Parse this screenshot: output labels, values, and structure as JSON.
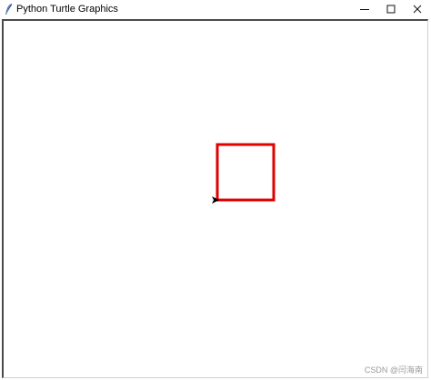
{
  "window": {
    "title": "Python Turtle Graphics",
    "icon": "feather-icon",
    "controls": {
      "minimize_icon": "minimize-icon",
      "maximize_icon": "maximize-icon",
      "close_icon": "close-icon"
    }
  },
  "canvas": {
    "background": "#ffffff",
    "square_color": "#e00000",
    "turtle_color": "#000000",
    "turtle_shape": "arrow-classic"
  },
  "watermark": {
    "text": "CSDN @闫海南"
  }
}
